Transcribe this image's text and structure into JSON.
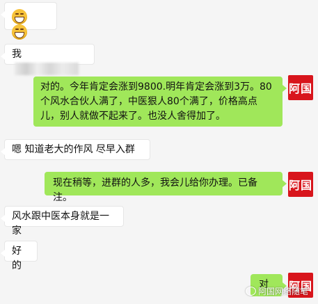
{
  "contact": {
    "avatar_text": "阿国"
  },
  "watermark": {
    "text": "阿国网络随笔"
  },
  "messages": [
    {
      "side": "left",
      "text": ""
    },
    {
      "side": "left",
      "text": "我"
    },
    {
      "side": "right",
      "text": "对的。今年肯定会涨到9800.明年肯定会涨到3万。80个风水合伙人满了，中医狠人80个满了，价格高点儿，别人就做不起来了。也没人舍得加了。"
    },
    {
      "side": "left",
      "text": "嗯 知道老大的作风 尽早入群"
    },
    {
      "side": "right",
      "text": "现在稍等，进群的人多，我会儿给你办理。已备注。"
    },
    {
      "side": "left",
      "text": "风水跟中医本身就是一家"
    },
    {
      "side": "left",
      "text": "好的"
    },
    {
      "side": "right",
      "text": "对"
    }
  ],
  "icons": [
    "grin-emoji-icon",
    "grin-emoji-icon"
  ]
}
